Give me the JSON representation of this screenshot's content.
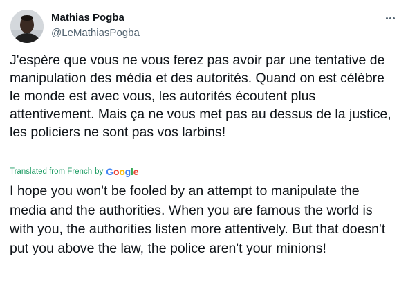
{
  "tweet": {
    "author": {
      "display_name": "Mathias Pogba",
      "handle": "@LeMathiasPogba",
      "avatar_icon": "user-avatar"
    },
    "more_icon": "more-horizontal-icon",
    "text_original": "J'espère que vous ne vous ferez pas avoir par une tentative de manipulation des média et des autorités. Quand on est célèbre le monde est avec vous, les autorités écoutent plus attentivement. Mais ça ne vous met pas au dessus de la justice, les policiers ne sont pas vos larbins!",
    "translation_note": {
      "prefix": "Translated from French",
      "by": "by",
      "provider_letters": [
        "G",
        "o",
        "o",
        "g",
        "l",
        "e"
      ]
    },
    "text_translated": "I hope you won't be fooled by an attempt to manipulate the media and the authorities. When you are famous the world is with you, the authorities listen more attentively. But that doesn't put you above the law, the police aren't your minions!"
  },
  "colors": {
    "text_primary": "#0f1419",
    "text_secondary": "#536471",
    "translated_green": "#1d9b63",
    "google_blue": "#4285F4",
    "google_red": "#EA4335",
    "google_yellow": "#FBBC05",
    "google_green": "#34A853"
  }
}
